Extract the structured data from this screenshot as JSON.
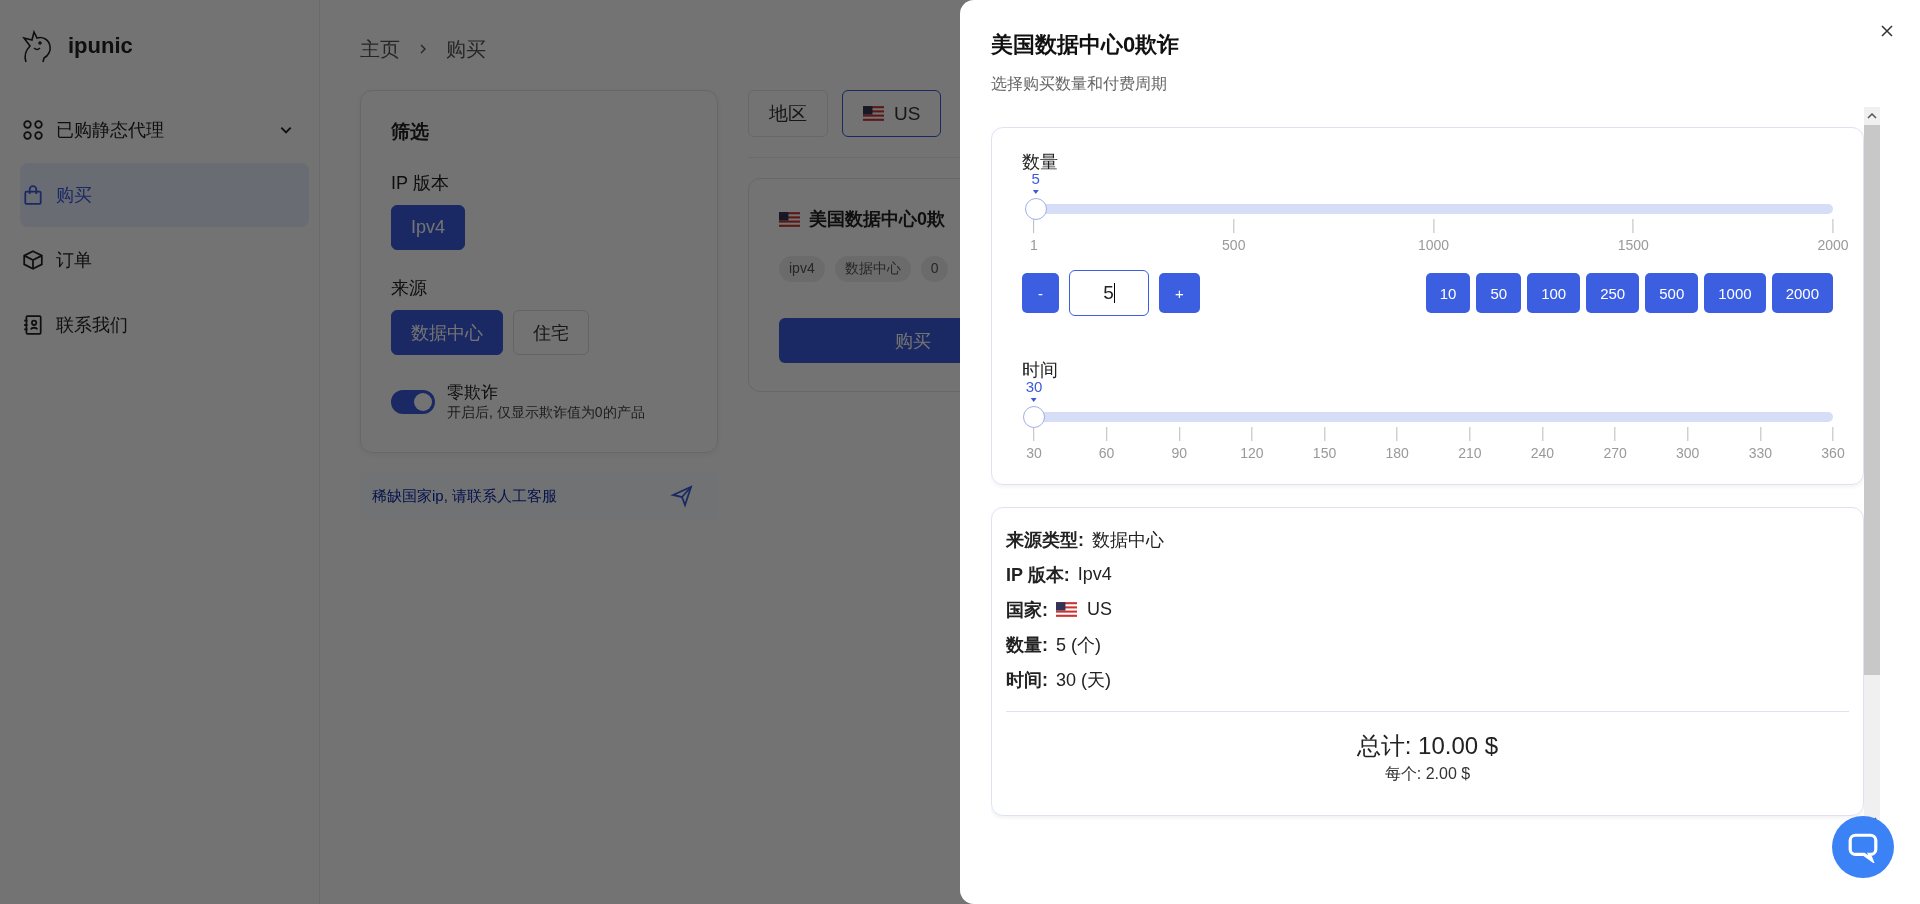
{
  "brand": {
    "name": "ipunic"
  },
  "nav": [
    {
      "label": "已购静态代理",
      "kind": "group",
      "expanded": false,
      "selected": false
    },
    {
      "label": "购买",
      "kind": "link",
      "selected": true
    },
    {
      "label": "订单",
      "kind": "link",
      "selected": false
    },
    {
      "label": "联系我们",
      "kind": "link",
      "selected": false
    }
  ],
  "breadcrumb": [
    "主页",
    "购买"
  ],
  "filter": {
    "title": "筛选",
    "groups": [
      {
        "label": "IP 版本",
        "options": [
          {
            "label": "Ipv4",
            "selected": true
          }
        ]
      },
      {
        "label": "来源",
        "options": [
          {
            "label": "数据中心",
            "selected": true
          },
          {
            "label": "住宅",
            "selected": false
          }
        ]
      }
    ],
    "toggle": {
      "label": "零欺诈",
      "hint": "开启后, 仅显示欺诈值为0的产品",
      "on": true
    }
  },
  "contact": {
    "text": "稀缺国家ip, 请联系人工客服"
  },
  "region_tabs": [
    {
      "label": "地区",
      "kind": "text",
      "selected": false
    },
    {
      "label": "US",
      "kind": "country",
      "selected": true
    }
  ],
  "product": {
    "title": "美国数据中心0欺",
    "tags": [
      "ipv4",
      "数据中心",
      "0"
    ],
    "button": "购买"
  },
  "drawer": {
    "title": "美国数据中心0欺诈",
    "subtitle": "选择购买数量和付费周期",
    "quantity": {
      "label": "数量",
      "value": "5",
      "level": 0.002,
      "ticks": [
        "1",
        "500",
        "1000",
        "1500",
        "2000"
      ],
      "minus": "-",
      "input": "5",
      "plus": "+",
      "presets": [
        "10",
        "50",
        "100",
        "250",
        "500",
        "1000",
        "2000"
      ]
    },
    "time": {
      "label": "时间",
      "value": "30",
      "level": 0,
      "ticks": [
        "30",
        "60",
        "90",
        "120",
        "150",
        "180",
        "210",
        "240",
        "270",
        "300",
        "330",
        "360"
      ]
    },
    "summary": [
      {
        "label": "来源类型:",
        "value": "数据中心",
        "kind": "text"
      },
      {
        "label": "IP 版本:",
        "value": "Ipv4",
        "kind": "text"
      },
      {
        "label": "国家:",
        "value": "US",
        "kind": "country"
      },
      {
        "label": "数量:",
        "value": "5 (个)",
        "kind": "text"
      },
      {
        "label": "时间:",
        "value": "30 (天)",
        "kind": "text"
      }
    ],
    "total": "总计:  10.00  $",
    "per_unit": "每个:  2.00  $"
  }
}
